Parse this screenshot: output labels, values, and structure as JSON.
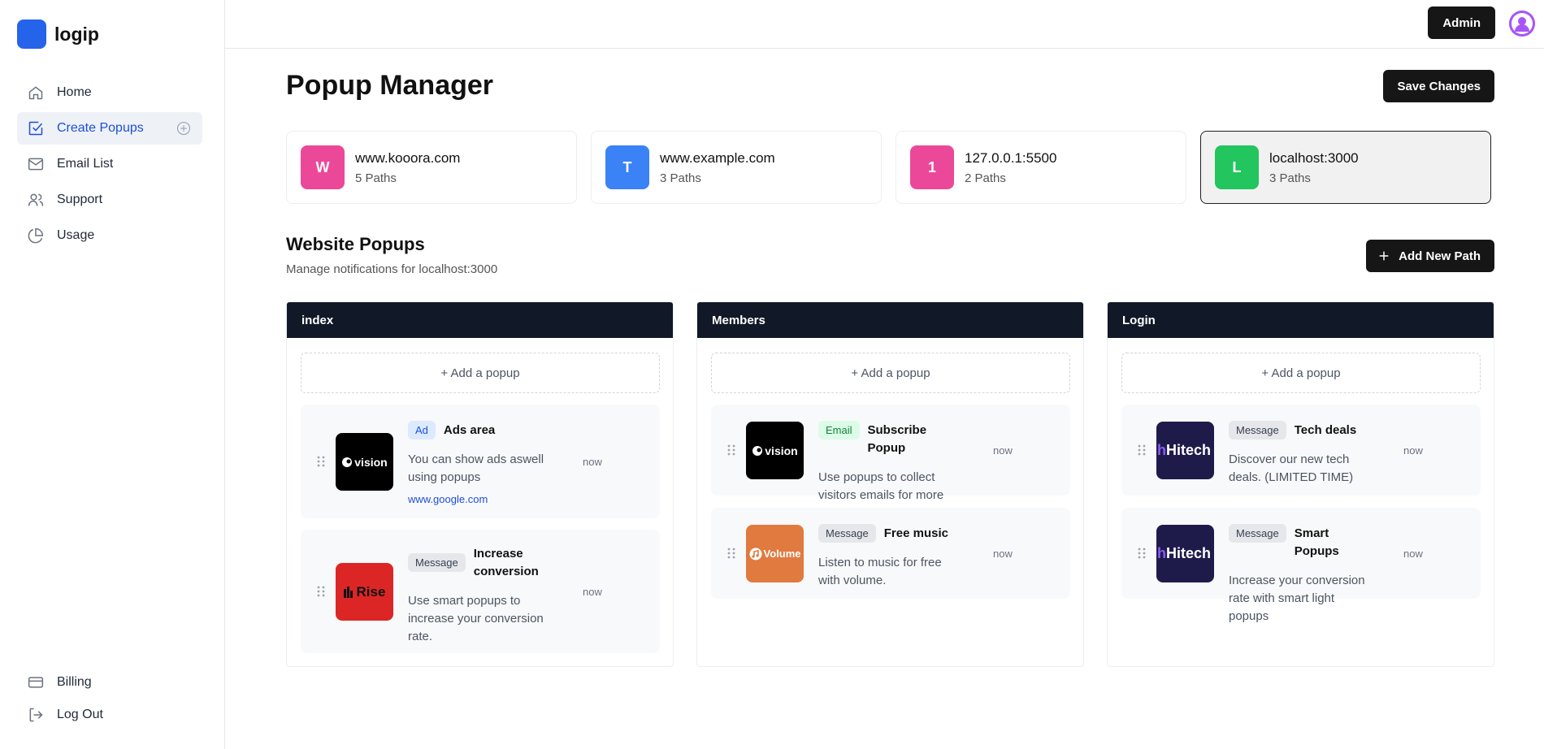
{
  "brand": {
    "name": "logip"
  },
  "sidebar": {
    "items": [
      {
        "label": "Home",
        "icon": "home-icon"
      },
      {
        "label": "Create Popups",
        "icon": "check-square-icon",
        "active": true
      },
      {
        "label": "Email List",
        "icon": "mail-icon"
      },
      {
        "label": "Support",
        "icon": "users-icon"
      },
      {
        "label": "Usage",
        "icon": "pie-chart-icon"
      }
    ],
    "bottom_items": [
      {
        "label": "Billing",
        "icon": "credit-card-icon"
      },
      {
        "label": "Log Out",
        "icon": "log-out-icon"
      }
    ]
  },
  "topbar": {
    "admin_label": "Admin"
  },
  "header": {
    "title": "Popup Manager",
    "save_label": "Save Changes"
  },
  "sites": [
    {
      "initial": "W",
      "domain": "www.kooora.com",
      "paths": "5 Paths",
      "color": "#ec4899"
    },
    {
      "initial": "T",
      "domain": "www.example.com",
      "paths": "3 Paths",
      "color": "#3b82f6"
    },
    {
      "initial": "1",
      "domain": "127.0.0.1:5500",
      "paths": "2 Paths",
      "color": "#ec4899"
    },
    {
      "initial": "L",
      "domain": "localhost:3000",
      "paths": "3 Paths",
      "color": "#22c55e",
      "selected": true
    }
  ],
  "section": {
    "title": "Website Popups",
    "subtitle": "Manage notifications for localhost:3000",
    "add_path_label": "Add New Path"
  },
  "columns": [
    {
      "title": "index",
      "add_label": "+ Add a popup",
      "popups": [
        {
          "tag": "Ad",
          "title": "Ads area",
          "description": "You can show ads aswell using popups",
          "link": "www.google.com",
          "time": "now",
          "thumb_text": "vision",
          "thumb_icon": "vision-logo"
        },
        {
          "tag": "Message",
          "title": "Increase conversion",
          "description": "Use smart popups to increase your conversion rate.",
          "time": "now",
          "thumb_text": "Rise",
          "thumb_icon": "rise-logo"
        }
      ]
    },
    {
      "title": "Members",
      "add_label": "+ Add a popup",
      "popups": [
        {
          "tag": "Email",
          "title": "Subscribe Popup",
          "description": "Use popups to collect visitors emails for more marketing.",
          "time": "now",
          "thumb_text": "vision",
          "thumb_icon": "vision-logo"
        },
        {
          "tag": "Message",
          "title": "Free music",
          "description": "Listen to music for free with volume.",
          "time": "now",
          "thumb_text": "Volume",
          "thumb_icon": "volume-logo"
        }
      ]
    },
    {
      "title": "Login",
      "add_label": "+ Add a popup",
      "popups": [
        {
          "tag": "Message",
          "title": "Tech deals",
          "description": "Discover our new tech deals. (LIMITED TIME)",
          "time": "now",
          "thumb_text": "Hitech",
          "thumb_icon": "hitech-logo"
        },
        {
          "tag": "Message",
          "title": "Smart Popups",
          "description": "Increase your conversion rate with smart light popups",
          "time": "now",
          "thumb_text": "Hitech",
          "thumb_icon": "hitech-logo"
        }
      ]
    }
  ]
}
